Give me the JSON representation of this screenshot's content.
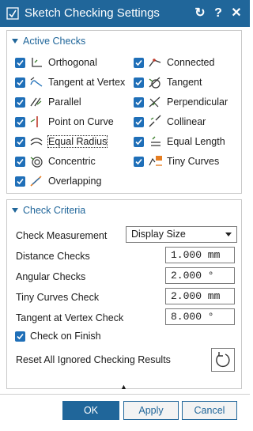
{
  "window": {
    "title": "Sketch Checking Settings",
    "icons": [
      "sketch-check-icon",
      "reset-icon",
      "help-icon",
      "close-icon"
    ],
    "help_glyph": "?",
    "close_glyph": "✕",
    "reset_glyph": "↻"
  },
  "active_checks": {
    "heading": "Active Checks",
    "left": [
      {
        "label": "Orthogonal",
        "checked": true,
        "icon": "orthogonal-icon"
      },
      {
        "label": "Tangent at Vertex",
        "checked": true,
        "icon": "tangent-vertex-icon"
      },
      {
        "label": "Parallel",
        "checked": true,
        "icon": "parallel-icon"
      },
      {
        "label": "Point on Curve",
        "checked": true,
        "icon": "point-on-curve-icon"
      },
      {
        "label": "Equal Radius",
        "checked": true,
        "icon": "equal-radius-icon"
      },
      {
        "label": "Concentric",
        "checked": true,
        "icon": "concentric-icon"
      },
      {
        "label": "Overlapping",
        "checked": true,
        "icon": "overlapping-icon"
      }
    ],
    "right": [
      {
        "label": "Connected",
        "checked": true,
        "icon": "connected-icon"
      },
      {
        "label": "Tangent",
        "checked": true,
        "icon": "tangent-icon"
      },
      {
        "label": "Perpendicular",
        "checked": true,
        "icon": "perpendicular-icon"
      },
      {
        "label": "Collinear",
        "checked": true,
        "icon": "collinear-icon"
      },
      {
        "label": "Equal Length",
        "checked": true,
        "icon": "equal-length-icon"
      },
      {
        "label": "Tiny Curves",
        "checked": true,
        "icon": "tiny-curves-icon"
      }
    ]
  },
  "check_criteria": {
    "heading": "Check Criteria",
    "measurement": {
      "label": "Check Measurement",
      "value": "Display Size"
    },
    "distance": {
      "label": "Distance Checks",
      "value": "1.000 mm"
    },
    "angular": {
      "label": "Angular Checks",
      "value": "2.000 °"
    },
    "tiny_curves": {
      "label": "Tiny Curves Check",
      "value": "2.000 mm"
    },
    "tangent_vertex": {
      "label": "Tangent at Vertex Check",
      "value": "8.000 °"
    },
    "check_on_finish": {
      "label": "Check on Finish",
      "checked": true
    },
    "reset": {
      "label": "Reset All Ignored Checking Results",
      "icon": "reset-icon"
    }
  },
  "footer": {
    "collapse_glyph": "▲",
    "ok": "OK",
    "apply": "Apply",
    "cancel": "Cancel"
  }
}
